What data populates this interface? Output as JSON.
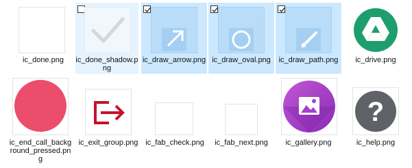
{
  "files": [
    {
      "name": "ic_done.png",
      "icon": "blank-white-icon"
    },
    {
      "name": "ic_done_shadow.png",
      "icon": "checkmark-icon",
      "checkbox": false
    },
    {
      "name": "ic_draw_arrow.png",
      "icon": "arrow-icon",
      "checkbox": true
    },
    {
      "name": "ic_draw_oval.png",
      "icon": "oval-icon",
      "checkbox": true
    },
    {
      "name": "ic_draw_path.png",
      "icon": "brush-icon",
      "checkbox": true
    },
    {
      "name": "ic_drive.png",
      "icon": "google-drive-icon"
    },
    {
      "name": "ic_end_call_background_pressed.png",
      "icon": "red-circle-icon"
    },
    {
      "name": "ic_exit_group.png",
      "icon": "exit-group-icon"
    },
    {
      "name": "ic_fab_check.png",
      "icon": "blank-white-icon"
    },
    {
      "name": "ic_fab_next.png",
      "icon": "blank-white-icon"
    },
    {
      "name": "ic_gallery.png",
      "icon": "gallery-icon"
    },
    {
      "name": "ic_help.png",
      "icon": "help-icon"
    }
  ],
  "colors": {
    "selection": "#cce8ff",
    "hover": "#e5f3ff",
    "drive_green": "#1e9e6e",
    "end_call_red": "#ec4d6b",
    "exit_red": "#c8102e",
    "gallery_purple": "#a63ec9",
    "help_gray": "#5f6368"
  }
}
